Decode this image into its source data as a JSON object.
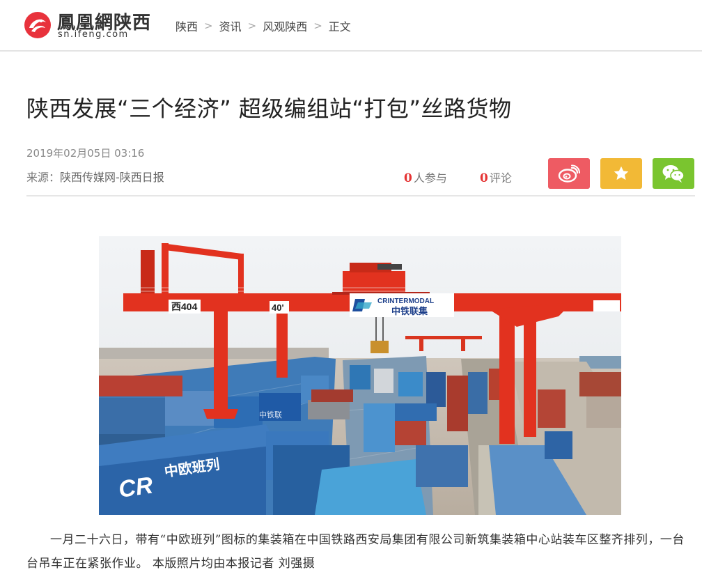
{
  "header": {
    "logo_text": "鳳凰網陕西",
    "logo_domain": "sn.ifeng.com",
    "breadcrumb": [
      "陕西",
      "资讯",
      "风观陕西",
      "正文"
    ]
  },
  "article": {
    "title": "陕西发展“三个经济”  超级编组站“打包”丝路货物",
    "date": "2019年02月05日  03:16",
    "source_label": "来源：",
    "source_name": "陕西传媒网-陕西日报",
    "participants_count": "0",
    "participants_label": "人参与",
    "comments_count": "0",
    "comments_label": "评论",
    "share": {
      "weibo_color": "#ee5b63",
      "favorite_color": "#f2b936",
      "wechat_color": "#7ac52f"
    },
    "photo": {
      "signs": [
        "西404",
        "40'",
        "CRINTERMODAL",
        "中铁联集",
        "中欧班列",
        "中铁联"
      ]
    },
    "caption": "一月二十六日，带有“中欧班列”图标的集装箱在中国铁路西安局集团有限公司新筑集装箱中心站装车区整齐排列，一台台吊车正在紧张作业。  本版照片均由本报记者  刘强摄"
  }
}
